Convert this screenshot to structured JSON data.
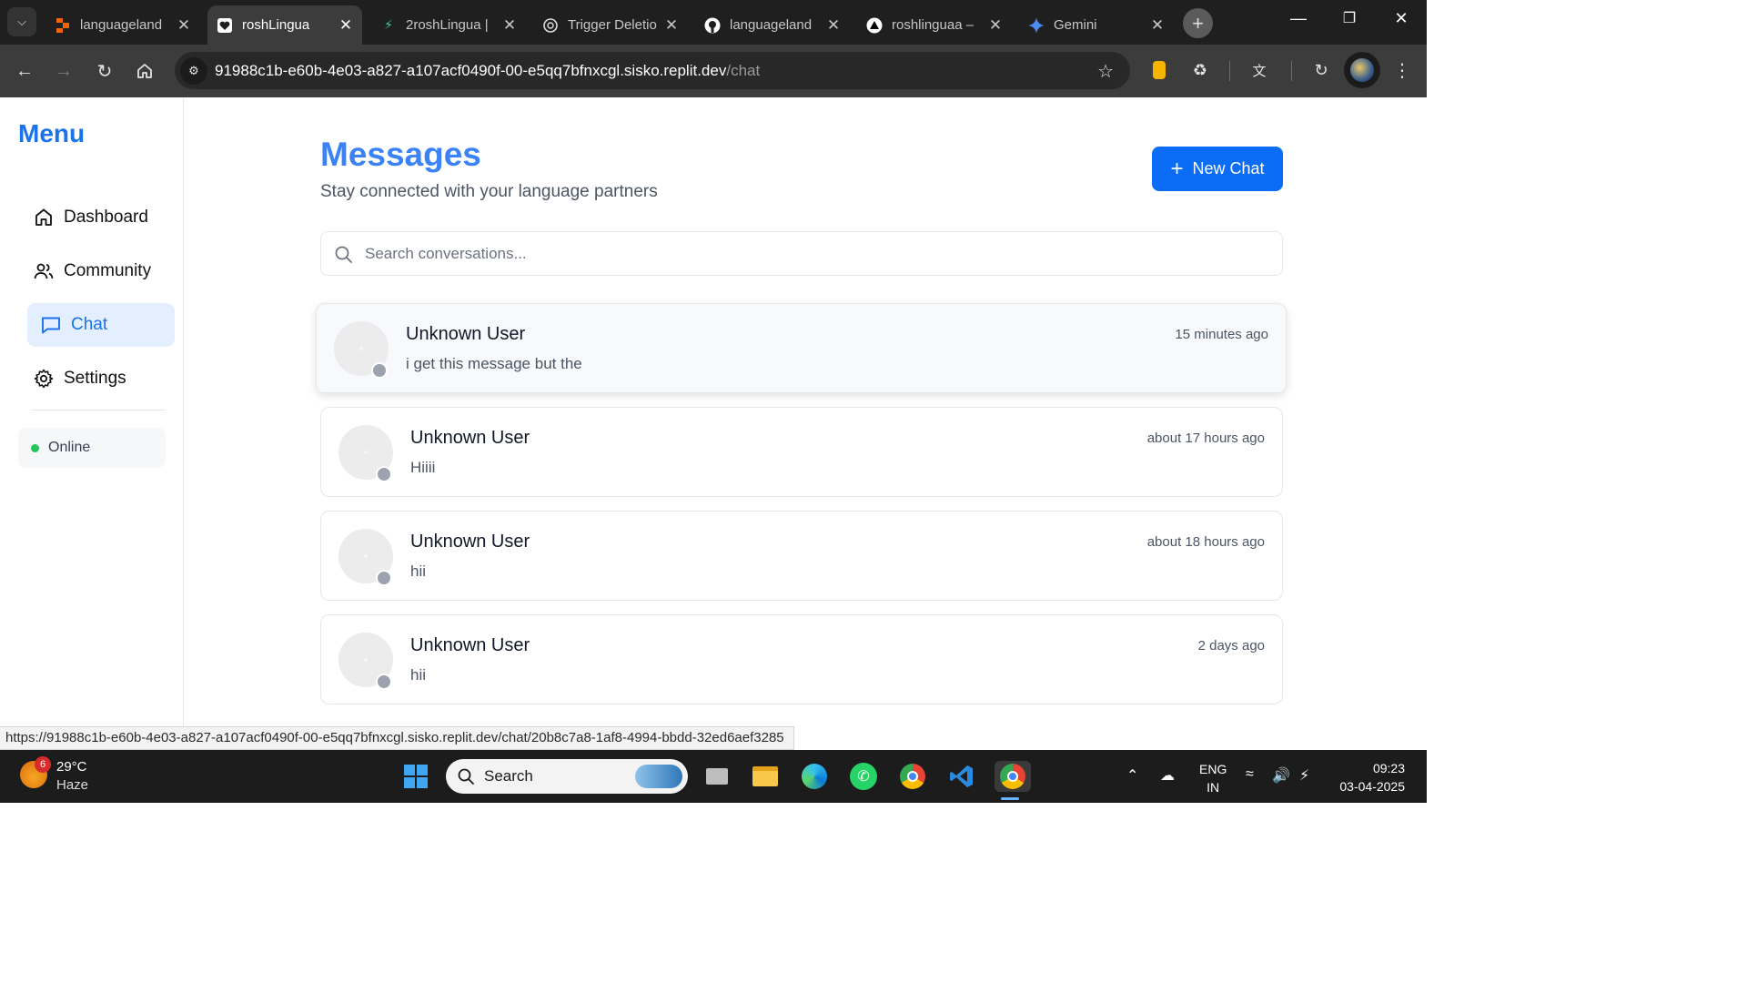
{
  "browser": {
    "tabs": [
      {
        "title": "languageland",
        "icon": "replit-icon"
      },
      {
        "title": "roshLingua",
        "icon": "heart-icon"
      },
      {
        "title": "2roshLingua |",
        "icon": "bolt-icon"
      },
      {
        "title": "Trigger Deletio",
        "icon": "openai-icon"
      },
      {
        "title": "languageland",
        "icon": "github-icon"
      },
      {
        "title": "roshlinguaa –",
        "icon": "vercel-icon"
      },
      {
        "title": "Gemini",
        "icon": "gemini-icon"
      }
    ],
    "url_host": "91988c1b-e60b-4e03-a827-a107acf0490f-00-e5qq7bfnxcgl.sisko.replit.dev",
    "url_path": "/chat",
    "status_url": "https://91988c1b-e60b-4e03-a827-a107acf0490f-00-e5qq7bfnxcgl.sisko.replit.dev/chat/20b8c7a8-1af8-4994-bbdd-32ed6aef3285"
  },
  "sidebar": {
    "title": "Menu",
    "items": [
      {
        "label": "Dashboard",
        "icon": "home-icon"
      },
      {
        "label": "Community",
        "icon": "users-icon"
      },
      {
        "label": "Chat",
        "icon": "chat-icon"
      },
      {
        "label": "Settings",
        "icon": "gear-icon"
      }
    ],
    "status": "Online"
  },
  "main": {
    "title": "Messages",
    "subtitle": "Stay connected with your language partners",
    "new_chat_label": "New Chat",
    "search_placeholder": "Search conversations...",
    "conversations": [
      {
        "name": "Unknown User",
        "message": "i get this message but the",
        "time": "15 minutes ago"
      },
      {
        "name": "Unknown User",
        "message": "Hiiii",
        "time": "about 17 hours ago"
      },
      {
        "name": "Unknown User",
        "message": "hii",
        "time": "about 18 hours ago"
      },
      {
        "name": "Unknown User",
        "message": "hii",
        "time": "2 days ago"
      }
    ]
  },
  "taskbar": {
    "weather_badge": "6",
    "temperature": "29°C",
    "condition": "Haze",
    "search_label": "Search",
    "lang_line1": "ENG",
    "lang_line2": "IN",
    "time": "09:23",
    "date": "03-04-2025"
  },
  "colors": {
    "accent": "#1a73e8",
    "button": "#0b6cf5",
    "online": "#22c55e"
  }
}
